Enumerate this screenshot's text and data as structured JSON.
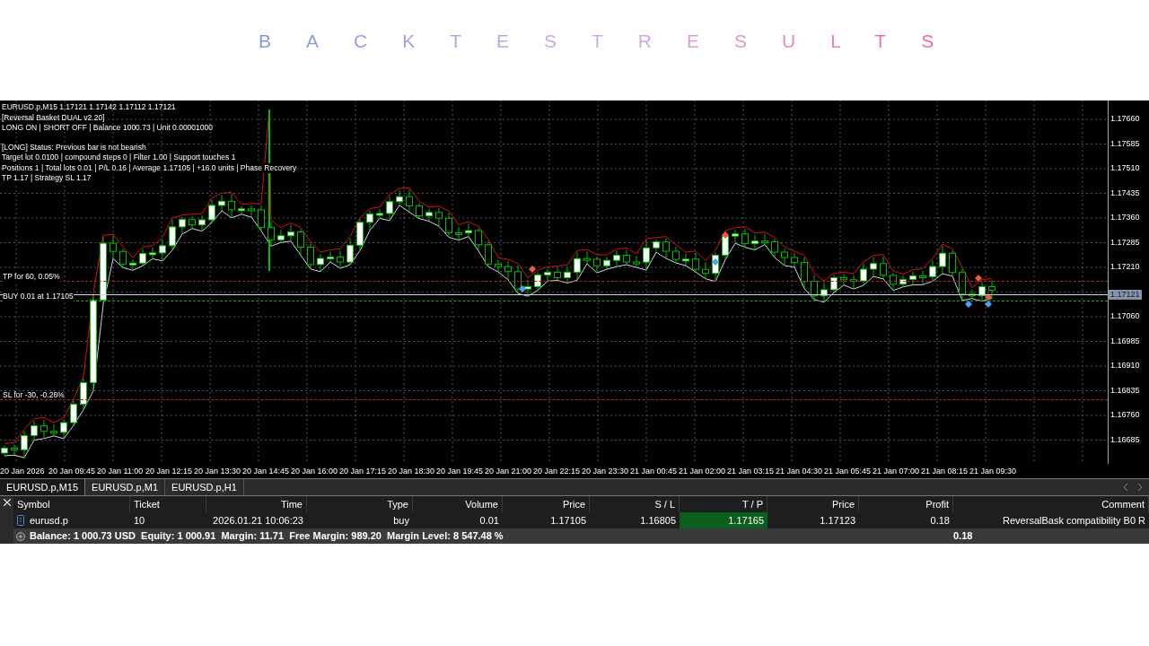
{
  "title": "BACKTESTRESULTS",
  "chart": {
    "header_lines": [
      "EURUSD.p,M15  1.17121 1.17142 1.17112 1.17121",
      "[Reversal Basket DUAL v2.20]",
      "LONG ON | SHORT OFF | Balance 1000.73 | Unit 0.00001000"
    ],
    "status_lines": [
      "[LONG] Status: Previous bar is not bearish",
      "Target lot 0.0100 | compound steps 0 | Filter 1.00 | Support touches 1",
      "Positions 1 | Total lots 0.01 | P/L 0.16 | Average 1.17105 | +16.0 units | Phase Recovery",
      "TP 1.17 | Strategy SL 1.17"
    ],
    "levels": [
      {
        "kind": "tp",
        "label": "TP for 60, 0.05%"
      },
      {
        "kind": "buy",
        "label": "BUY 0.01 at 1.17105"
      },
      {
        "kind": "sl",
        "label": "SL for -30, -0.26%"
      }
    ],
    "price_axis_upper": [
      "1.17660",
      "1.17585",
      "1.17510",
      "1.17435",
      "1.17360",
      "1.17285",
      "1.17210"
    ],
    "current_price": "1.17121",
    "price_axis_lower": [
      "1.17060",
      "1.16985",
      "1.16910",
      "1.16835",
      "1.16760",
      "1.16685"
    ],
    "time_axis": [
      "20 Jan 2026",
      "20 Jan 09:45",
      "20 Jan 11:00",
      "20 Jan 12:15",
      "20 Jan 13:30",
      "20 Jan 14:45",
      "20 Jan 16:00",
      "20 Jan 17:15",
      "20 Jan 18:30",
      "20 Jan 19:45",
      "20 Jan 21:00",
      "20 Jan 22:15",
      "20 Jan 23:30",
      "21 Jan 00:45",
      "21 Jan 02:00",
      "21 Jan 03:15",
      "21 Jan 04:30",
      "21 Jan 05:45",
      "21 Jan 07:00",
      "21 Jan 08:15",
      "21 Jan 09:30"
    ]
  },
  "tabs": [
    {
      "label": "EURUSD.p,M15",
      "selected": true
    },
    {
      "label": "EURUSD.p,M1",
      "selected": false
    },
    {
      "label": "EURUSD.p,H1",
      "selected": false
    }
  ],
  "table": {
    "columns": [
      "Symbol",
      "Ticket",
      "Time",
      "Type",
      "Volume",
      "Price",
      "S / L",
      "T / P",
      "Price",
      "Profit",
      "Comment"
    ],
    "rows": [
      {
        "cells": [
          {
            "text": "eurusd.p",
            "highlighted": false
          },
          {
            "text": "10",
            "highlighted": false
          },
          {
            "text": "2026.01.21 10:06:23",
            "highlighted": false
          },
          {
            "text": "buy",
            "highlighted": false
          },
          {
            "text": "0.01",
            "highlighted": false
          },
          {
            "text": "1.17105",
            "highlighted": false
          },
          {
            "text": "1.16805",
            "highlighted": false
          },
          {
            "text": "1.17165",
            "highlighted": true
          },
          {
            "text": "1.17123",
            "highlighted": false
          },
          {
            "text": "0.18",
            "highlighted": false
          },
          {
            "text": "ReversalBask compatibility B0 R",
            "highlighted": false
          }
        ]
      }
    ],
    "summary": {
      "text": "Balance: 1 000.73 USD  Equity: 1 000.91  Margin: 11.71  Free Margin: 989.20  Margin Level: 8 547.48 %",
      "profit": "0.18"
    }
  }
}
